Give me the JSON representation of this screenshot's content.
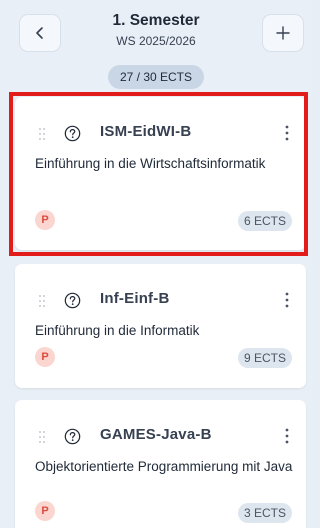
{
  "header": {
    "back_icon": "chevron-left-icon",
    "title": "1. Semester",
    "subtitle": "WS 2025/2026",
    "add_icon": "plus-icon",
    "ects_total": "27 / 30 ECTS"
  },
  "colors": {
    "highlight": "#e21b1b",
    "badge_bg": "#fbd5cf",
    "badge_text": "#dc4b3e",
    "ects_pill": "#dde5ef"
  },
  "modules": [
    {
      "code": "ISM-EidWI-B",
      "name": "Einführung in die Wirtschaftsinformatik",
      "badge": "P",
      "ects": "6 ECTS",
      "selected": true
    },
    {
      "code": "Inf-Einf-B",
      "name": "Einführung in die Informatik",
      "badge": "P",
      "ects": "9 ECTS",
      "selected": false
    },
    {
      "code": "GAMES-Java-B",
      "name": "Objektorientierte Programmierung mit Java",
      "badge": "P",
      "ects": "3 ECTS",
      "selected": false
    }
  ]
}
